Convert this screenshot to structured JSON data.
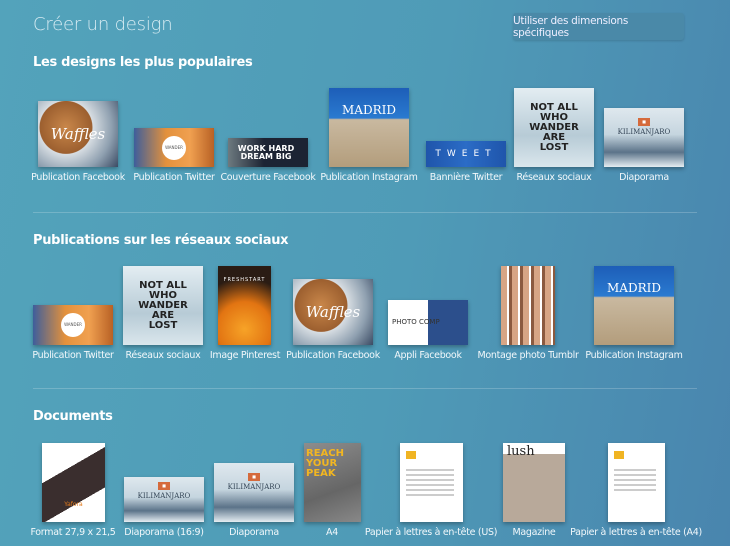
{
  "header": {
    "title": "Créer un design",
    "custom_dimensions_button": "Utiliser des dimensions spécifiques"
  },
  "sections": [
    {
      "title": "Les designs les plus populaires",
      "items": [
        {
          "label": "Publication Facebook",
          "thumb_text": "Waffles"
        },
        {
          "label": "Publication Twitter",
          "thumb_text": "WANDER"
        },
        {
          "label": "Couverture Facebook",
          "thumb_text": "WORK HARD DREAM BIG"
        },
        {
          "label": "Publication Instagram",
          "thumb_text": "MADRID"
        },
        {
          "label": "Bannière Twitter",
          "thumb_text": "TWEET"
        },
        {
          "label": "Réseaux sociaux",
          "thumb_text": "NOT ALL WHO WANDER ARE LOST"
        },
        {
          "label": "Diaporama",
          "thumb_text": "KILIMANJARO"
        }
      ]
    },
    {
      "title": "Publications sur les réseaux sociaux",
      "items": [
        {
          "label": "Publication Twitter",
          "thumb_text": "WANDER"
        },
        {
          "label": "Réseaux sociaux",
          "thumb_text": "NOT ALL WHO WANDER ARE LOST"
        },
        {
          "label": "Image Pinterest",
          "thumb_text": "FRESHSTART"
        },
        {
          "label": "Publication Facebook",
          "thumb_text": "Waffles"
        },
        {
          "label": "Appli Facebook",
          "thumb_text": "PHOTO COMP"
        },
        {
          "label": "Montage photo Tumblr"
        },
        {
          "label": "Publication Instagram",
          "thumb_text": "MADRID"
        }
      ]
    },
    {
      "title": "Documents",
      "items": [
        {
          "label": "Format 27,9 x 21,5",
          "thumb_text": "Yafora"
        },
        {
          "label": "Diaporama (16:9)",
          "thumb_text": "KILIMANJARO"
        },
        {
          "label": "Diaporama",
          "thumb_text": "KILIMANJARO"
        },
        {
          "label": "A4",
          "thumb_text": "REACH YOUR PEAK"
        },
        {
          "label": "Papier à lettres à en-tête (US)"
        },
        {
          "label": "Magazine",
          "thumb_text": "lush"
        },
        {
          "label": "Papier à lettres à en-tête (A4)"
        }
      ]
    }
  ],
  "colors": {
    "background": "#4f9bb7",
    "button": "#4a89a8",
    "accent_orange": "#d56a3c"
  }
}
